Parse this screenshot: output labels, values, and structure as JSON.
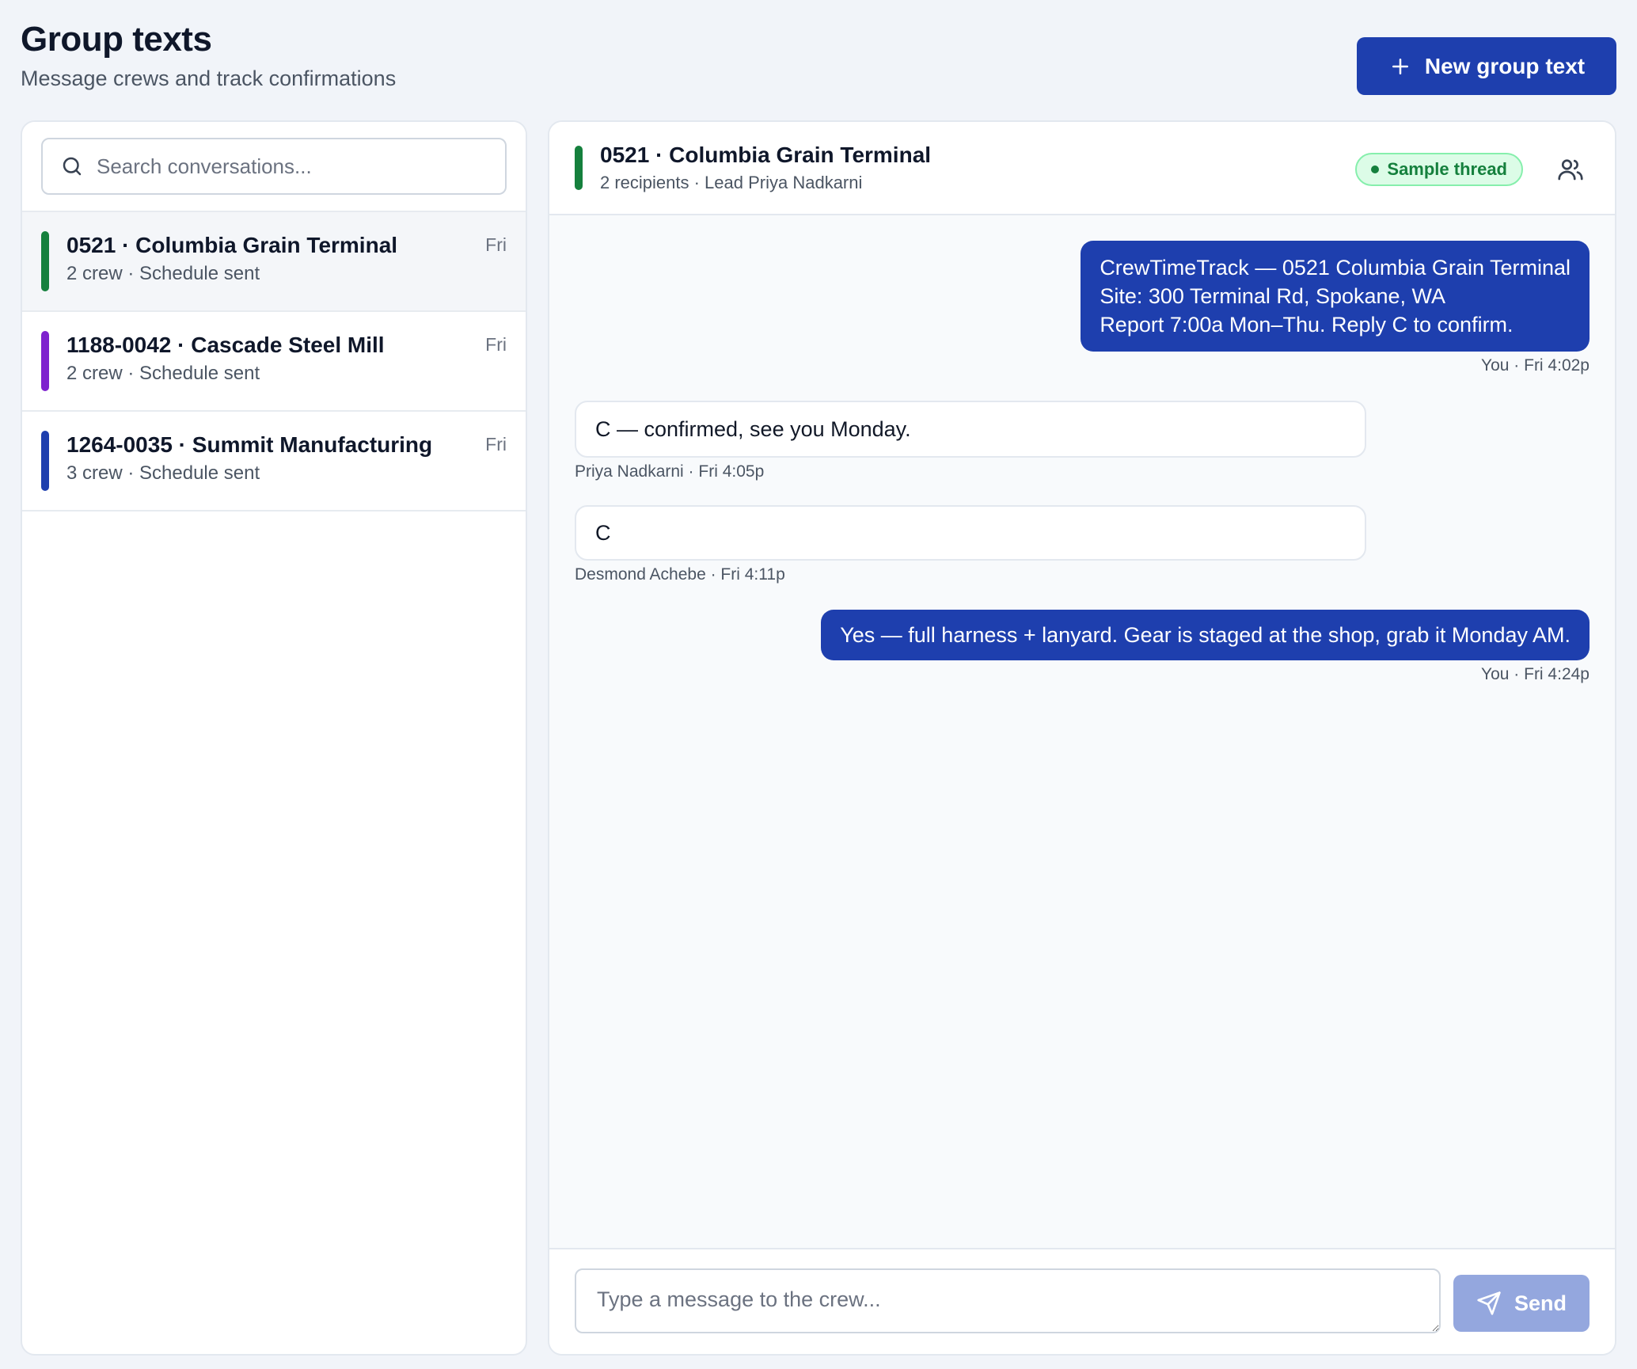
{
  "header": {
    "title": "Group texts",
    "subtitle": "Message crews and track confirmations",
    "new_button_label": "New group text"
  },
  "search": {
    "placeholder": "Search conversations..."
  },
  "conversations": [
    {
      "name": "0521 · Columbia Grain Terminal",
      "meta": "2 crew · Schedule sent",
      "time": "Fri",
      "color": "#15803d"
    },
    {
      "name": "1188-0042 · Cascade Steel Mill",
      "meta": "2 crew · Schedule sent",
      "time": "Fri",
      "color": "#7e22ce"
    },
    {
      "name": "1264-0035 · Summit Manufacturing",
      "meta": "3 crew · Schedule sent",
      "time": "Fri",
      "color": "#1e3fae"
    }
  ],
  "thread": {
    "title": "0521 · Columbia Grain Terminal",
    "subtitle": "2 recipients · Lead Priya Nadkarni",
    "badge": "Sample thread",
    "messages": [
      {
        "lines": [
          "CrewTimeTrack — 0521 Columbia Grain Terminal",
          "Site: 300 Terminal Rd, Spokane, WA",
          "Report 7:00a Mon–Thu. Reply C to confirm."
        ],
        "meta": "You · Fri 4:02p"
      },
      {
        "text": "C — confirmed, see you Monday.",
        "meta": "Priya Nadkarni · Fri 4:05p"
      },
      {
        "text": "C",
        "meta": "Desmond Achebe · Fri 4:11p"
      },
      {
        "text": "Yes — full harness + lanyard. Gear is staged at the shop, grab it Monday AM.",
        "meta": "You · Fri 4:24p"
      }
    ]
  },
  "composer": {
    "placeholder": "Type a message to the crew...",
    "send_label": "Send"
  },
  "colors": {
    "accent": "#1e3fae",
    "send_disabled": "#94a7de",
    "sample_green": "#15803d"
  }
}
